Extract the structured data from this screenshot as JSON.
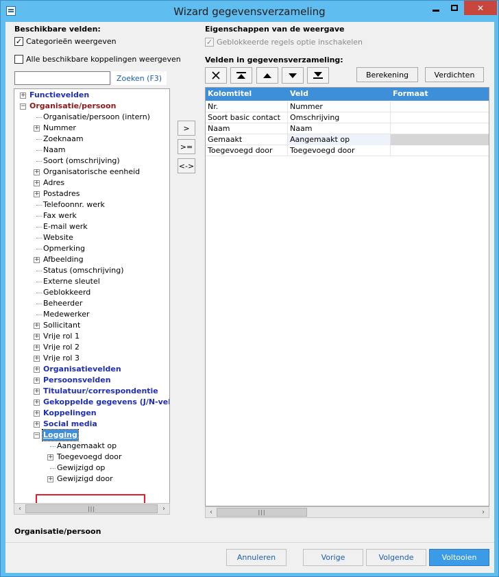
{
  "window": {
    "title": "Wizard gegevensverzameling"
  },
  "left": {
    "header": "Beschikbare velden:",
    "show_categories": {
      "label": "Categorieën weergeven",
      "checked": true
    },
    "show_all_links": {
      "label": "Alle beschikbare koppelingen weergeven",
      "checked": false
    },
    "search": {
      "value": "",
      "button": "Zoeken (F3)"
    },
    "tree": [
      {
        "label": "Functievelden",
        "style": "bold-blue",
        "level": 0,
        "expander": "+"
      },
      {
        "label": "Organisatie/persoon",
        "style": "bold-red",
        "level": 0,
        "expander": "-"
      },
      {
        "label": "Organisatie/persoon (intern)",
        "level": 1,
        "expander": ""
      },
      {
        "label": "Nummer",
        "level": 1,
        "expander": "+"
      },
      {
        "label": "Zoeknaam",
        "level": 1,
        "expander": ""
      },
      {
        "label": "Naam",
        "level": 1,
        "expander": ""
      },
      {
        "label": "Soort (omschrijving)",
        "level": 1,
        "expander": ""
      },
      {
        "label": "Organisatorische eenheid",
        "level": 1,
        "expander": "+"
      },
      {
        "label": "Adres",
        "level": 1,
        "expander": "+"
      },
      {
        "label": "Postadres",
        "level": 1,
        "expander": "+"
      },
      {
        "label": "Telefoonnr. werk",
        "level": 1,
        "expander": ""
      },
      {
        "label": "Fax werk",
        "level": 1,
        "expander": ""
      },
      {
        "label": "E-mail werk",
        "level": 1,
        "expander": ""
      },
      {
        "label": "Website",
        "level": 1,
        "expander": ""
      },
      {
        "label": "Opmerking",
        "level": 1,
        "expander": ""
      },
      {
        "label": "Afbeelding",
        "level": 1,
        "expander": "+"
      },
      {
        "label": "Status (omschrijving)",
        "level": 1,
        "expander": ""
      },
      {
        "label": "Externe sleutel",
        "level": 1,
        "expander": ""
      },
      {
        "label": "Geblokkeerd",
        "level": 1,
        "expander": ""
      },
      {
        "label": "Beheerder",
        "level": 1,
        "expander": ""
      },
      {
        "label": "Medewerker",
        "level": 1,
        "expander": ""
      },
      {
        "label": "Sollicitant",
        "level": 1,
        "expander": "+"
      },
      {
        "label": "Vrije rol 1",
        "level": 1,
        "expander": "+"
      },
      {
        "label": "Vrije rol 2",
        "level": 1,
        "expander": "+"
      },
      {
        "label": "Vrije rol 3",
        "level": 1,
        "expander": "+"
      },
      {
        "label": "Organisatievelden",
        "style": "bold-blue",
        "level": 1,
        "expander": "+"
      },
      {
        "label": "Persoonsvelden",
        "style": "bold-blue",
        "level": 1,
        "expander": "+"
      },
      {
        "label": "Titulatuur/correspondentie",
        "style": "bold-blue",
        "level": 1,
        "expander": "+"
      },
      {
        "label": "Gekoppelde gegevens (J/N-veld",
        "style": "bold-blue",
        "level": 1,
        "expander": "+"
      },
      {
        "label": "Koppelingen",
        "style": "bold-blue",
        "level": 1,
        "expander": "+"
      },
      {
        "label": "Social media",
        "style": "bold-blue",
        "level": 1,
        "expander": "+"
      },
      {
        "label": "Logging",
        "style": "selected",
        "level": 1,
        "expander": "-"
      },
      {
        "label": "Aangemaakt op",
        "level": 2,
        "expander": ""
      },
      {
        "label": "Toegevoegd door",
        "level": 2,
        "expander": "+"
      },
      {
        "label": "Gewijzigd op",
        "level": 2,
        "expander": ""
      },
      {
        "label": "Gewijzigd door",
        "level": 2,
        "expander": "+"
      }
    ]
  },
  "move_buttons": {
    "add": ">",
    "add_all": ">=",
    "swap": "<->"
  },
  "right": {
    "header": "Eigenschappen van de weergave",
    "blocked_rules": {
      "label": "Geblokkeerde regels optie inschakelen",
      "checked": true,
      "disabled": true
    },
    "fields_header": "Velden in gegevensverzameling:",
    "tools": {
      "delete": "delete-icon",
      "top": "move-top-icon",
      "up": "move-up-icon",
      "down": "move-down-icon",
      "bottom": "move-bottom-icon"
    },
    "calc_button": "Berekening",
    "compress_button": "Verdichten",
    "columns": [
      "Kolomtitel",
      "Veld",
      "Formaat"
    ],
    "rows": [
      {
        "title": "Nr.",
        "field": "Nummer",
        "format": ""
      },
      {
        "title": "Soort basic contact",
        "field": "Omschrijving",
        "format": ""
      },
      {
        "title": "Naam",
        "field": "Naam",
        "format": ""
      },
      {
        "title": "Gemaakt",
        "field": "Aangemaakt op",
        "format": ""
      },
      {
        "title": "Toegevoegd door",
        "field": "Toegevoegd door",
        "format": ""
      }
    ]
  },
  "footer": {
    "path": "Organisatie/persoon",
    "cancel": "Annuleren",
    "prev": "Vorige",
    "next": "Volgende",
    "finish": "Voltooien"
  },
  "colors": {
    "titlebar": "#5fbdf0",
    "selection": "#3c8fd8",
    "highlight_box": "#e0202a",
    "close": "#c9463d"
  }
}
